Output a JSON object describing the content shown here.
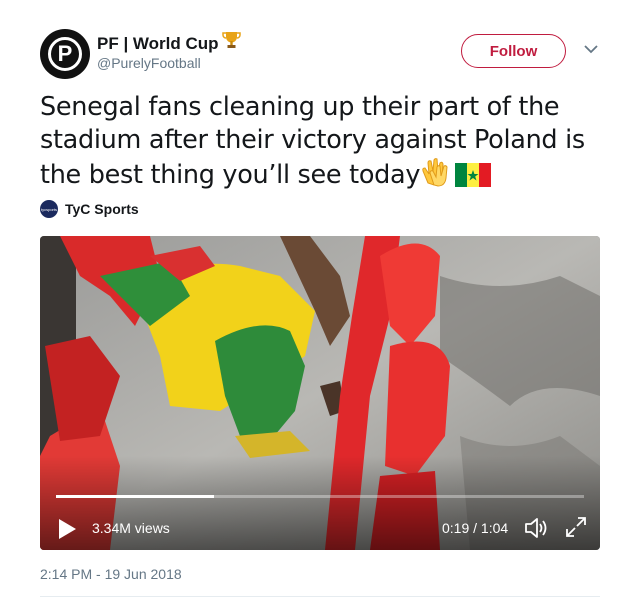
{
  "author": {
    "display_name": "PF | World Cup",
    "handle": "@PurelyFootball",
    "avatar_letter": "P"
  },
  "follow_label": "Follow",
  "tweet_text": "Senegal fans cleaning up their part of the stadium after their victory against Poland is the best thing you’ll see today",
  "media_source": {
    "name": "TyC Sports",
    "logo_text": "tycsports"
  },
  "video": {
    "views": "3.34M views",
    "time": "0:19 / 1:04",
    "progress": 0.3
  },
  "timestamp": "2:14 PM - 19 Jun 2018",
  "colors": {
    "follow_accent": "#c01c3f",
    "text_primary": "#14171a",
    "text_secondary": "#657786"
  },
  "icons": [
    "trophy-icon",
    "clapping-hands-icon",
    "senegal-flag-icon",
    "play-icon",
    "volume-icon",
    "fullscreen-icon",
    "chevron-down-icon"
  ]
}
